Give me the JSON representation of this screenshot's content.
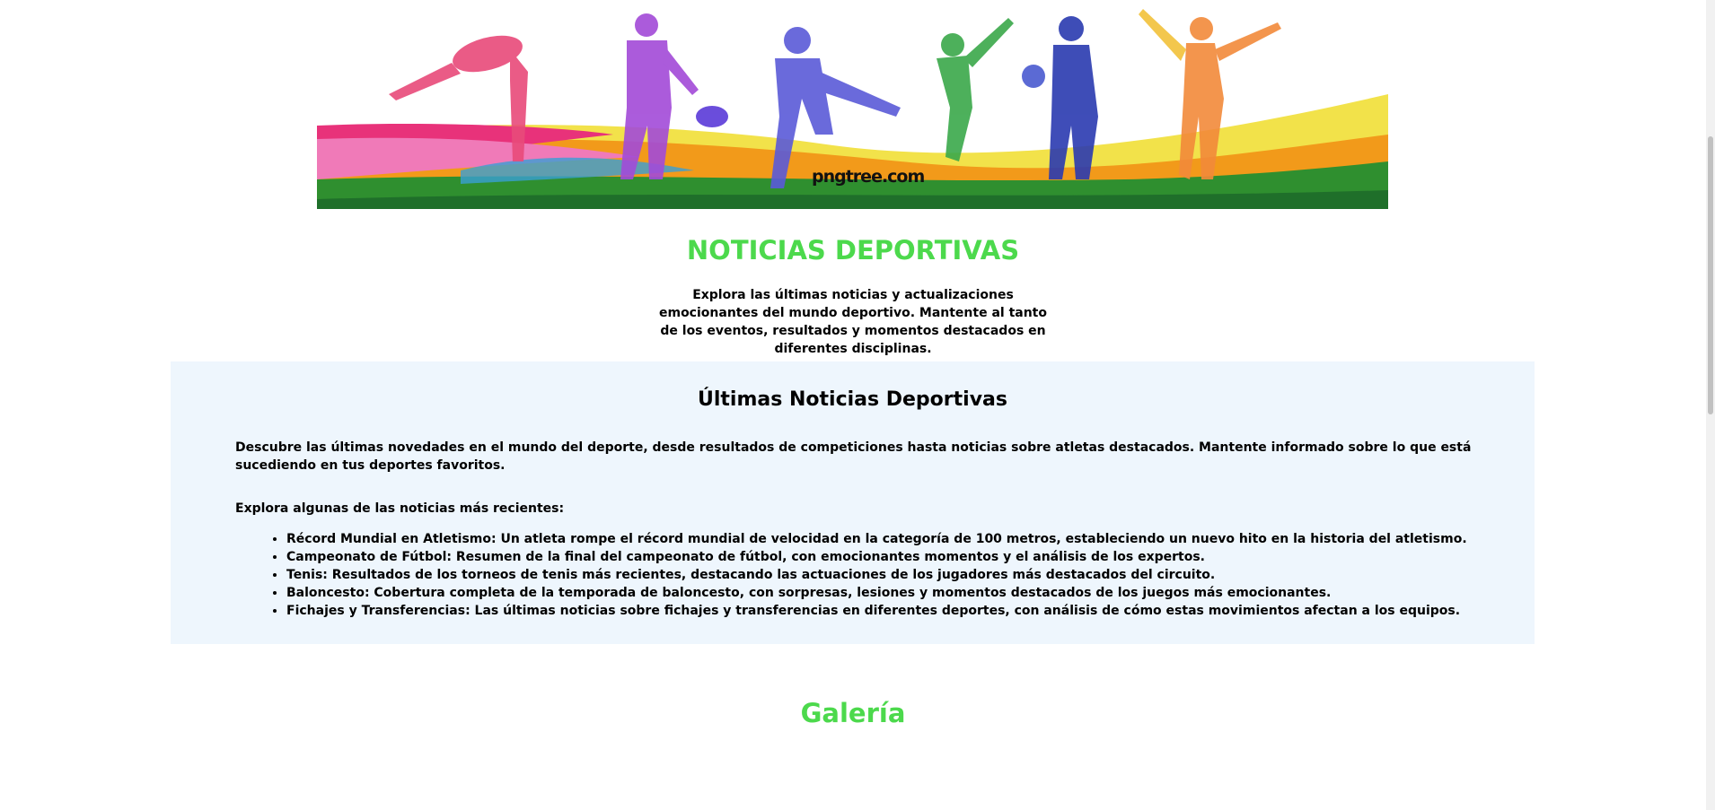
{
  "banner": {
    "watermark": "pngtree.com",
    "colors": {
      "green": "#2f8f2f",
      "yellow": "#f2e24a",
      "pink": "#e8327a",
      "orange": "#f29a1a",
      "blue": "#3a7bd5"
    }
  },
  "header": {
    "title": "NOTICIAS DEPORTIVAS",
    "intro": "Explora las últimas noticias y actualizaciones emocionantes del mundo deportivo. Mantente al tanto de los eventos, resultados y momentos destacados en diferentes disciplinas."
  },
  "news": {
    "title": "Últimas Noticias Deportivas",
    "description": "Descubre las últimas novedades en el mundo del deporte, desde resultados de competiciones hasta noticias sobre atletas destacados. Mantente informado sobre lo que está sucediendo en tus deportes favoritos.",
    "subtitle": "Explora algunas de las noticias más recientes:",
    "items": [
      "Récord Mundial en Atletismo: Un atleta rompe el récord mundial de velocidad en la categoría de 100 metros, estableciendo un nuevo hito en la historia del atletismo.",
      "Campeonato de Fútbol: Resumen de la final del campeonato de fútbol, con emocionantes momentos y el análisis de los expertos.",
      "Tenis: Resultados de los torneos de tenis más recientes, destacando las actuaciones de los jugadores más destacados del circuito.",
      "Baloncesto: Cobertura completa de la temporada de baloncesto, con sorpresas, lesiones y momentos destacados de los juegos más emocionantes.",
      "Fichajes y Transferencias: Las últimas noticias sobre fichajes y transferencias en diferentes deportes, con análisis de cómo estas movimientos afectan a los equipos."
    ]
  },
  "gallery": {
    "title": "Galería"
  },
  "accent_color": "#4cd94c",
  "section_bg": "#eef6fd"
}
